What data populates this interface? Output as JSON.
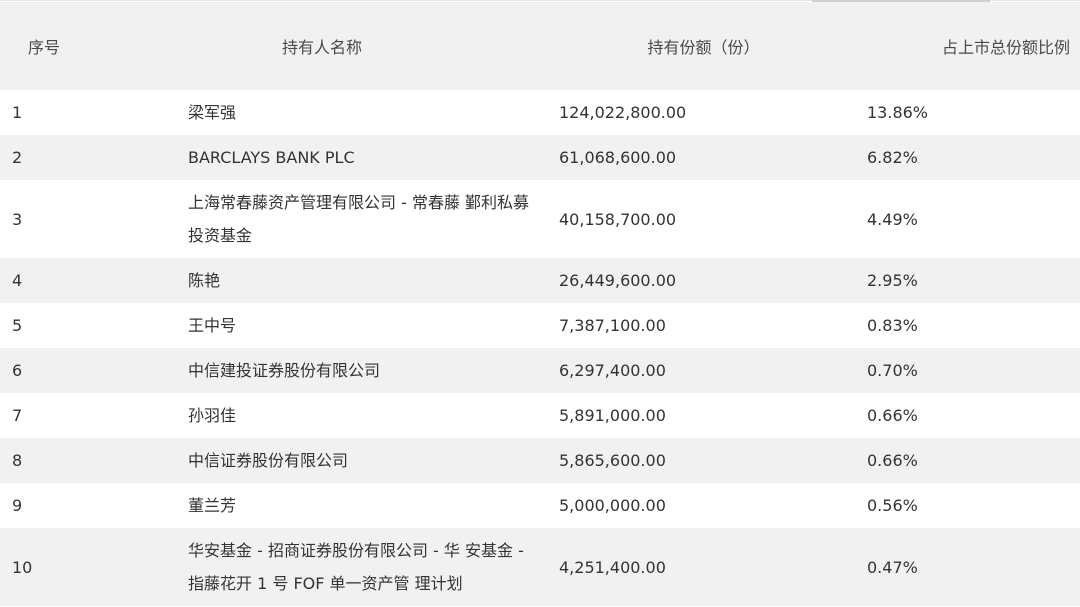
{
  "table": {
    "headers": [
      "序号",
      "持有人名称",
      "持有份额（份）",
      "占上市总份额比例"
    ],
    "rows": [
      {
        "no": "1",
        "name": "梁军强",
        "shares": "124,022,800.00",
        "ratio": "13.86%"
      },
      {
        "no": "2",
        "name": "BARCLAYS BANK PLC",
        "shares": "61,068,600.00",
        "ratio": "6.82%"
      },
      {
        "no": "3",
        "name": "上海常春藤资产管理有限公司 - 常春藤 鄞利私募投资基金",
        "shares": "40,158,700.00",
        "ratio": "4.49%"
      },
      {
        "no": "4",
        "name": "陈艳",
        "shares": "26,449,600.00",
        "ratio": "2.95%"
      },
      {
        "no": "5",
        "name": "王中号",
        "shares": "7,387,100.00",
        "ratio": "0.83%"
      },
      {
        "no": "6",
        "name": "中信建投证券股份有限公司",
        "shares": "6,297,400.00",
        "ratio": "0.70%"
      },
      {
        "no": "7",
        "name": "孙羽佳",
        "shares": "5,891,000.00",
        "ratio": "0.66%"
      },
      {
        "no": "8",
        "name": "中信证券股份有限公司",
        "shares": "5,865,600.00",
        "ratio": "0.66%"
      },
      {
        "no": "9",
        "name": "董兰芳",
        "shares": "5,000,000.00",
        "ratio": "0.56%"
      },
      {
        "no": "10",
        "name": "华安基金 - 招商证券股份有限公司 - 华 安基金 - 指藤花开 1 号 FOF 单一资产管 理计划",
        "shares": "4,251,400.00",
        "ratio": "0.47%"
      }
    ]
  }
}
